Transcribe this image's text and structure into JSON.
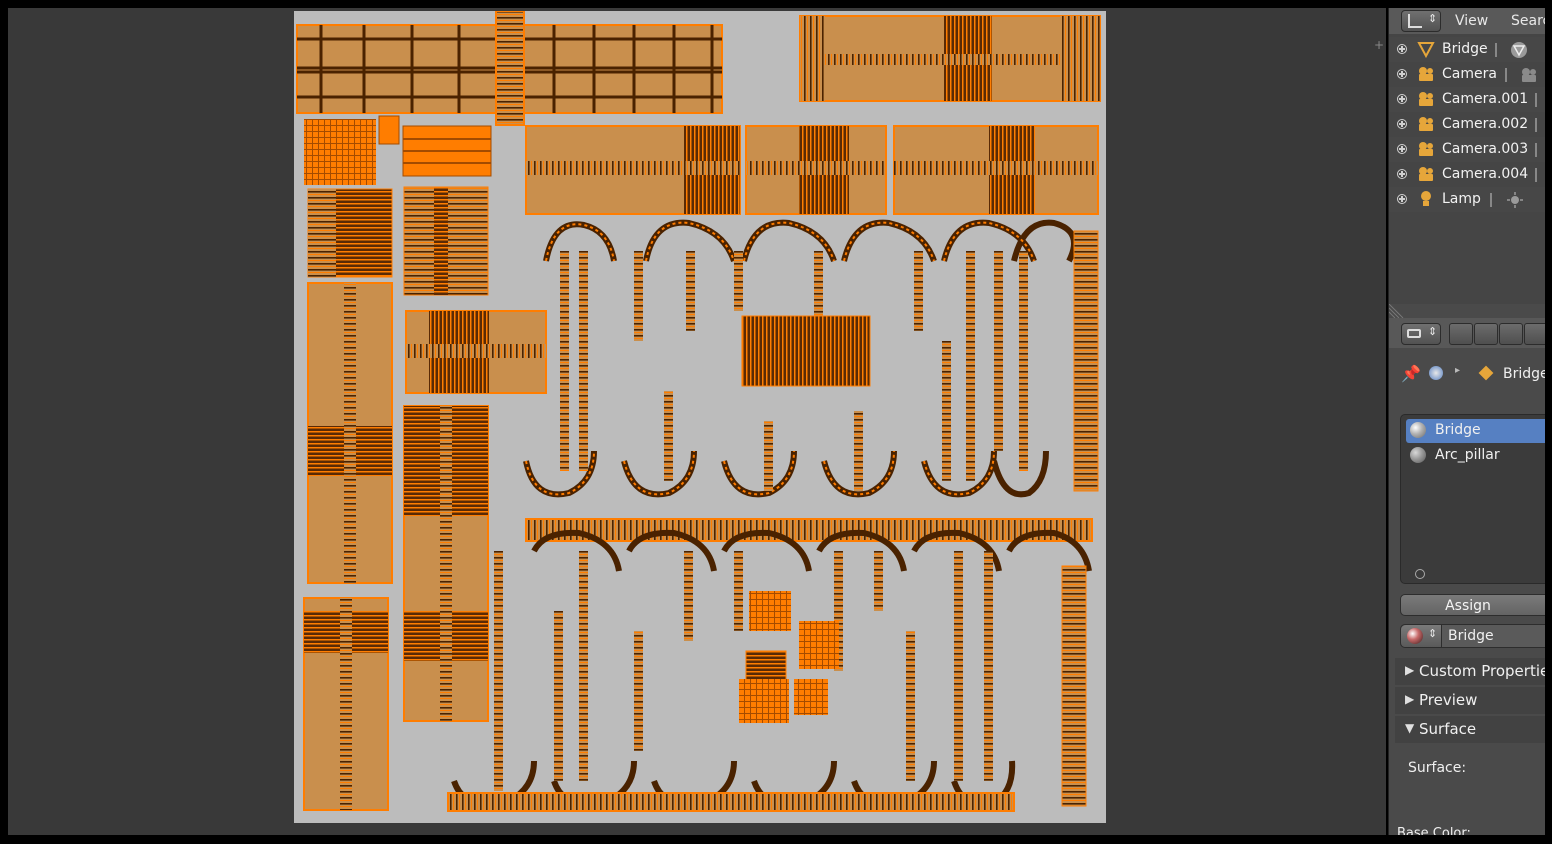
{
  "outliner": {
    "view_menu": "View",
    "search_menu": "Search",
    "objects": [
      {
        "name": "Bridge",
        "icon": "mesh-icon",
        "data_icon": "mesh-data-icon"
      },
      {
        "name": "Camera",
        "icon": "camera-icon",
        "data_icon": "camera-data-icon"
      },
      {
        "name": "Camera.001",
        "icon": "camera-icon",
        "data_icon": ""
      },
      {
        "name": "Camera.002",
        "icon": "camera-icon",
        "data_icon": ""
      },
      {
        "name": "Camera.003",
        "icon": "camera-icon",
        "data_icon": ""
      },
      {
        "name": "Camera.004",
        "icon": "camera-icon",
        "data_icon": ""
      },
      {
        "name": "Lamp",
        "icon": "lamp-icon",
        "data_icon": "lamp-data-icon"
      }
    ]
  },
  "properties": {
    "breadcrumb_object": "Bridge",
    "material_slots": [
      {
        "name": "Bridge",
        "selected": true
      },
      {
        "name": "Arc_pillar",
        "selected": false
      }
    ],
    "assign_label": "Assign",
    "active_material": "Bridge",
    "panels": [
      {
        "label": "Custom Properties",
        "expanded": false
      },
      {
        "label": "Preview",
        "expanded": false
      },
      {
        "label": "Surface",
        "expanded": true
      }
    ],
    "surface_label": "Surface:",
    "base_color_label": "Base Color:"
  },
  "colors": {
    "uv_background": "#bcbcbc",
    "uv_face": "#c98f4d",
    "uv_edge": "#ff7d00",
    "uv_edge_dark": "#4a2200",
    "selection": "#5680c2",
    "editor_bg": "#393939"
  }
}
